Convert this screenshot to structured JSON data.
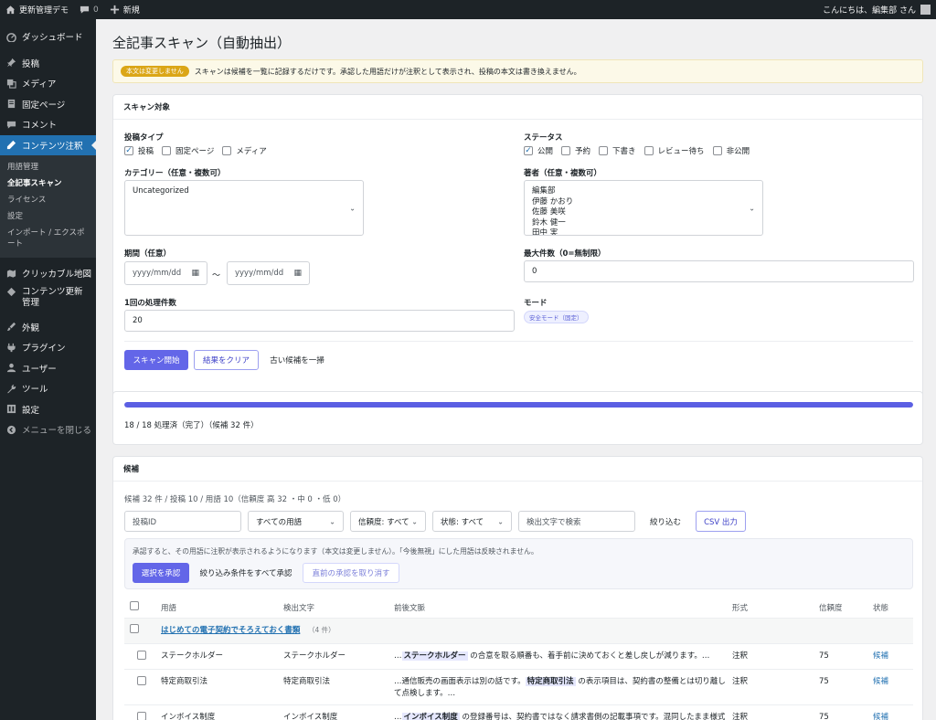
{
  "adminbar": {
    "site_name": "更新管理デモ",
    "comments_count": "0",
    "new_label": "新規",
    "greeting": "こんにちは、編集部 さん"
  },
  "sidebar": {
    "items": [
      {
        "label": "ダッシュボード",
        "icon": "dashboard-icon"
      },
      {
        "label": "投稿",
        "icon": "pin-icon"
      },
      {
        "label": "メディア",
        "icon": "media-icon"
      },
      {
        "label": "固定ページ",
        "icon": "page-icon"
      },
      {
        "label": "コメント",
        "icon": "comment-icon"
      },
      {
        "label": "コンテンツ注釈",
        "icon": "edit-icon"
      }
    ],
    "submenu": [
      "用語管理",
      "全記事スキャン",
      "ライセンス",
      "設定",
      "インポート / エクスポート"
    ],
    "items2": [
      {
        "label": "クリッカブル地図",
        "icon": "map-icon"
      },
      {
        "label": "コンテンツ更新管理",
        "icon": "diamond-icon"
      },
      {
        "label": "外観",
        "icon": "brush-icon"
      },
      {
        "label": "プラグイン",
        "icon": "plugin-icon"
      },
      {
        "label": "ユーザー",
        "icon": "user-icon"
      },
      {
        "label": "ツール",
        "icon": "wrench-icon"
      },
      {
        "label": "設定",
        "icon": "settings-icon"
      },
      {
        "label": "メニューを閉じる",
        "icon": "collapse-icon"
      }
    ]
  },
  "page": {
    "title": "全記事スキャン（自動抽出）",
    "notice_badge": "本文は変更しません",
    "notice_text": "スキャンは候補を一覧に記録するだけです。承認した用語だけが注釈として表示され、投稿の本文は書き換えません。"
  },
  "scan": {
    "header": "スキャン対象",
    "post_type_label": "投稿タイプ",
    "post_types": [
      {
        "label": "投稿",
        "checked": true
      },
      {
        "label": "固定ページ",
        "checked": false
      },
      {
        "label": "メディア",
        "checked": false
      }
    ],
    "status_label": "ステータス",
    "statuses": [
      {
        "label": "公開",
        "checked": true
      },
      {
        "label": "予約",
        "checked": false
      },
      {
        "label": "下書き",
        "checked": false
      },
      {
        "label": "レビュー待ち",
        "checked": false
      },
      {
        "label": "非公開",
        "checked": false
      }
    ],
    "category_label": "カテゴリー（任意・複数可）",
    "category_options": [
      "Uncategorized"
    ],
    "author_label": "著者（任意・複数可）",
    "author_options": [
      "編集部",
      "伊藤 かおり",
      "佐藤 美咲",
      "鈴木 健一",
      "田中 実"
    ],
    "period_label": "期間（任意）",
    "date_placeholder": "yyyy/mm/dd",
    "date_sep": "〜",
    "max_label": "最大件数（0=無制限）",
    "max_value": "0",
    "batch_label": "1回の処理件数",
    "batch_value": "20",
    "mode_label": "モード",
    "mode_value": "安全モード（固定）",
    "start_btn": "スキャン開始",
    "clear_btn": "結果をクリア",
    "purge_btn": "古い候補を一掃"
  },
  "progress": {
    "percent": 100,
    "text": "18 / 18 処理済（完了）（候補 32 件）"
  },
  "candidates": {
    "header": "候補",
    "summary": "候補 32 件 / 投稿 10 / 用語 10（信頼度 高 32 ・中 0 ・低 0）",
    "post_id_placeholder": "投稿ID",
    "term_filter": "すべての用語",
    "confidence_filter": "信頼度: すべて",
    "status_filter": "状態: すべて",
    "search_placeholder": "検出文字で検索",
    "filter_btn": "絞り込む",
    "csv_btn": "CSV 出力",
    "info_text": "承認すると、その用語に注釈が表示されるようになります（本文は変更しません）。「今後無視」にした用語は反映されません。",
    "approve_selected": "選択を承認",
    "approve_all": "絞り込み条件をすべて承認",
    "undo_approve": "直前の承認を取り消す",
    "columns": {
      "term": "用語",
      "detected": "検出文字",
      "context": "前後文脈",
      "format": "形式",
      "confidence": "信頼度",
      "status": "状態"
    },
    "group": {
      "title": "はじめての電子契約でそろえておく書類",
      "count": "（4 件）"
    },
    "rows": [
      {
        "term": "ステークホルダー",
        "detected": "ステークホルダー",
        "pre": "…",
        "hit": "ステークホルダー",
        "post": " の合意を取る順番も、着手前に決めておくと差し戻しが減ります。…",
        "format": "注釈",
        "confidence": "75",
        "status": "候補"
      },
      {
        "term": "特定商取引法",
        "detected": "特定商取引法",
        "pre": "…通信販売の画面表示は別の話です。",
        "hit": "特定商取引法",
        "post": " の表示項目は、契約書の整備とは切り離して点検します。…",
        "format": "注釈",
        "confidence": "75",
        "status": "候補"
      },
      {
        "term": "インボイス制度",
        "detected": "インボイス制度",
        "pre": "…",
        "hit": "インボイス制度",
        "post": " の登録番号は、契約書ではなく請求書側の記載事項です。混同したまま様式を作ると、両方を直す羽目になります。…",
        "format": "注釈",
        "confidence": "75",
        "status": "候補"
      }
    ]
  }
}
